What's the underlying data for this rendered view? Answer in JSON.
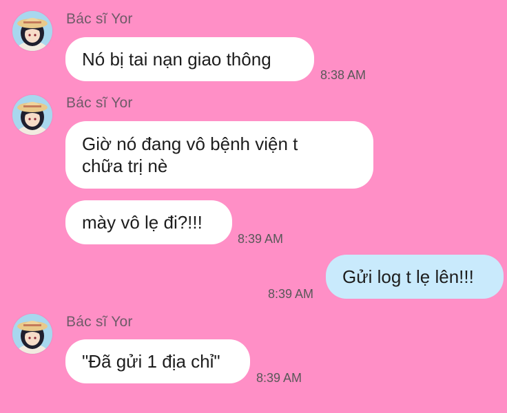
{
  "colors": {
    "background": "#ff8fc6",
    "incoming_bubble": "#ffffff",
    "outgoing_bubble": "#c9eafc",
    "sender_name": "#6f5b68",
    "timestamp": "#585858"
  },
  "messages": [
    {
      "sender": "Bác sĩ Yor",
      "avatar_icon": "avatar-icon",
      "text": "Nó bị tai nạn giao thông",
      "time": "8:38 AM"
    },
    {
      "sender": "Bác sĩ Yor",
      "avatar_icon": "avatar-icon",
      "text": "Giờ nó đang vô bệnh viện t\nchữa trị nè"
    },
    {
      "text": "mày vô lẹ đi?!!!",
      "time": "8:39 AM"
    },
    {
      "direction": "outgoing",
      "text": "Gửi log t lẹ lên!!!",
      "time": "8:39 AM"
    },
    {
      "sender": "Bác sĩ Yor",
      "avatar_icon": "avatar-icon",
      "text": "\"Đã gửi 1 địa chỉ\"",
      "time": "8:39 AM"
    }
  ]
}
